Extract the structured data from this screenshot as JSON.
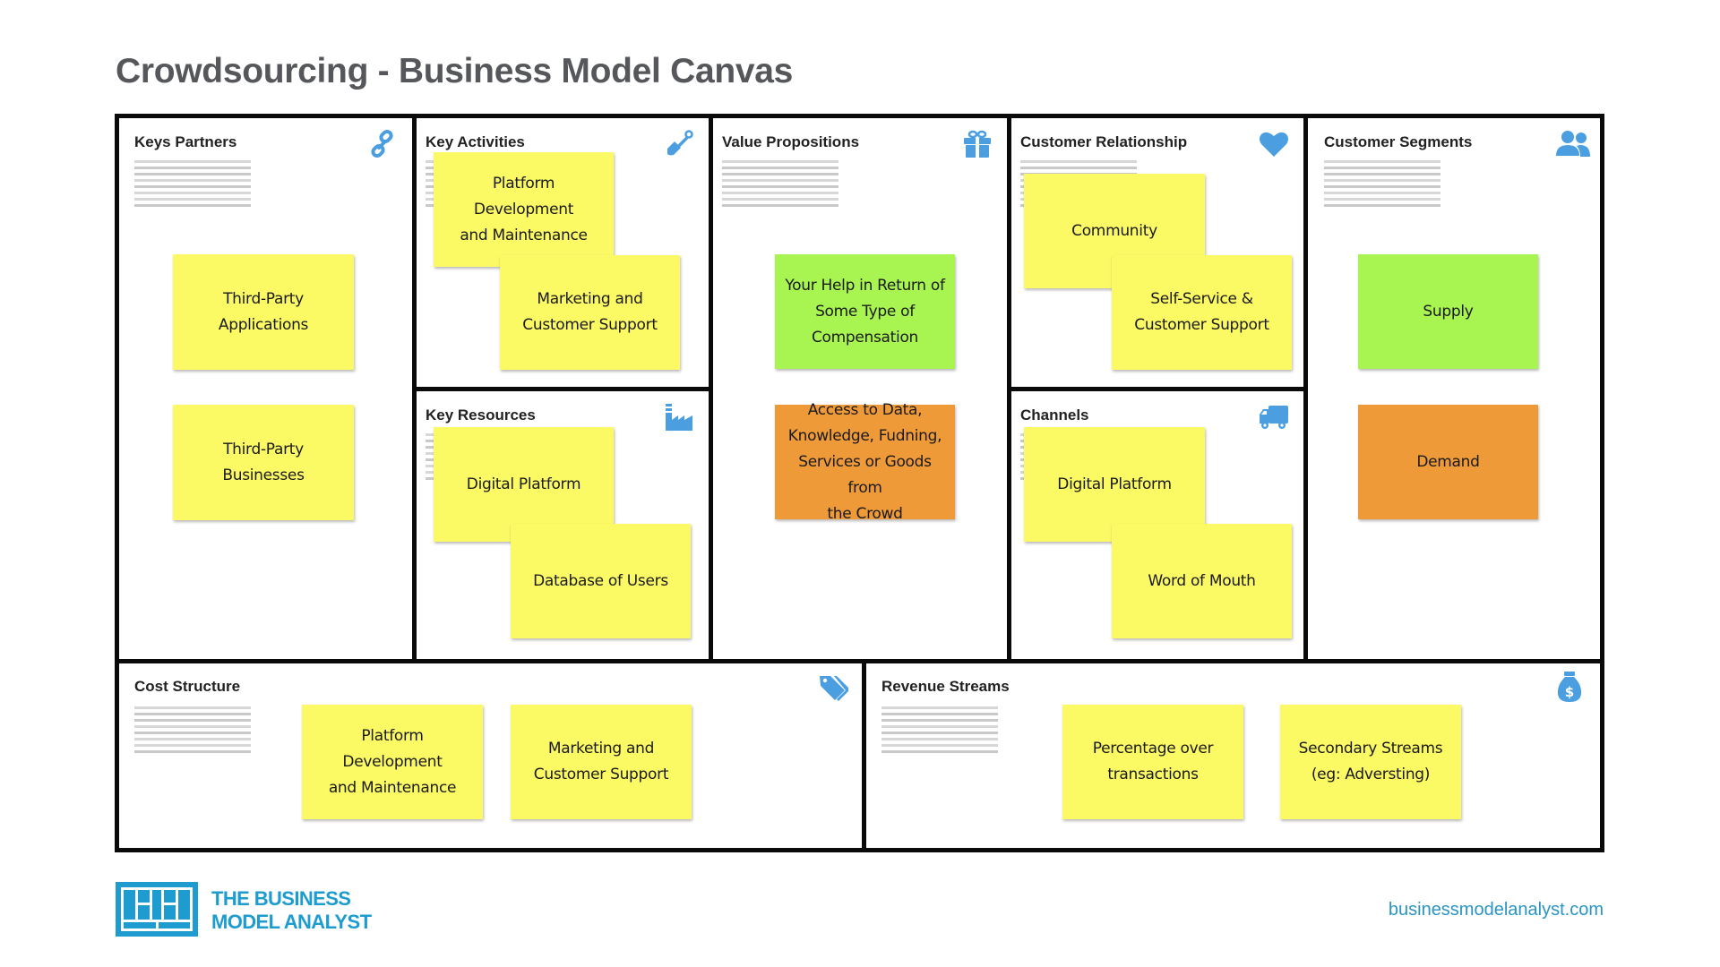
{
  "title": "Crowdsourcing - Business Model Canvas",
  "colors": {
    "border": "#0a0a0a",
    "icon": "#4b9ee0",
    "note_yellow": "#fbf964",
    "note_green": "#a8f450",
    "note_orange": "#ef9a39",
    "brand": "#1e9cd0"
  },
  "blocks": {
    "key_partners": {
      "title": "Keys Partners",
      "icon": "link-icon",
      "notes": [
        {
          "text": "Third-Party Applications",
          "color": "yellow"
        },
        {
          "text": "Third-Party Businesses",
          "color": "yellow"
        }
      ]
    },
    "key_activities": {
      "title": "Key Activities",
      "icon": "shovel-icon",
      "notes": [
        {
          "text": "Platform Development\nand Maintenance",
          "color": "yellow"
        },
        {
          "text": "Marketing and\nCustomer Support",
          "color": "yellow"
        }
      ]
    },
    "key_resources": {
      "title": "Key Resources",
      "icon": "factory-icon",
      "notes": [
        {
          "text": "Digital Platform",
          "color": "yellow"
        },
        {
          "text": "Database of Users",
          "color": "yellow"
        }
      ]
    },
    "value_propositions": {
      "title": "Value Propositions",
      "icon": "gift-icon",
      "notes": [
        {
          "text": "Your Help in Return of\nSome Type of\nCompensation",
          "color": "green"
        },
        {
          "text": "Access to Data,\nKnowledge, Fudning,\nServices or Goods from\nthe Crowd",
          "color": "orange"
        }
      ]
    },
    "customer_relationship": {
      "title": "Customer Relationship",
      "icon": "heart-icon",
      "notes": [
        {
          "text": "Community",
          "color": "yellow"
        },
        {
          "text": "Self-Service &\nCustomer Support",
          "color": "yellow"
        }
      ]
    },
    "channels": {
      "title": "Channels",
      "icon": "truck-icon",
      "notes": [
        {
          "text": "Digital Platform",
          "color": "yellow"
        },
        {
          "text": "Word of Mouth",
          "color": "yellow"
        }
      ]
    },
    "customer_segments": {
      "title": "Customer Segments",
      "icon": "users-icon",
      "notes": [
        {
          "text": "Supply",
          "color": "green"
        },
        {
          "text": "Demand",
          "color": "orange"
        }
      ]
    },
    "cost_structure": {
      "title": "Cost Structure",
      "icon": "tags-icon",
      "notes": [
        {
          "text": "Platform Development\nand Maintenance",
          "color": "yellow"
        },
        {
          "text": "Marketing and\nCustomer Support",
          "color": "yellow"
        }
      ]
    },
    "revenue_streams": {
      "title": "Revenue Streams",
      "icon": "money-bag-icon",
      "notes": [
        {
          "text": "Percentage over\ntransactions",
          "color": "yellow"
        },
        {
          "text": "Secondary Streams\n(eg: Adversting)",
          "color": "yellow"
        }
      ]
    }
  },
  "footer": {
    "logo_line1": "THE BUSINESS",
    "logo_line2": "MODEL ANALYST",
    "website": "businessmodelanalyst.com"
  }
}
